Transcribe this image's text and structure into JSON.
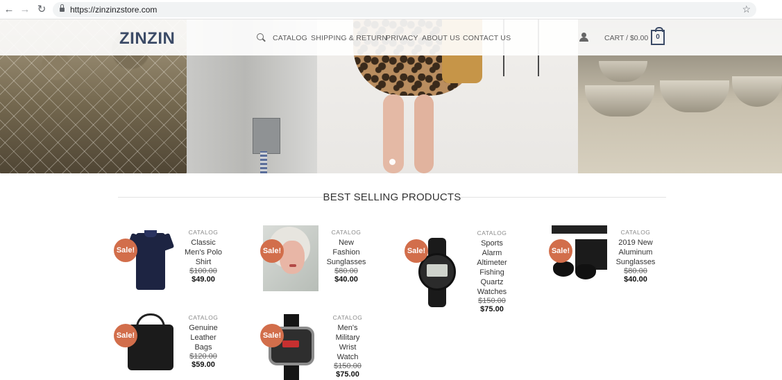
{
  "browser": {
    "url": "https://zinzinzstore.com",
    "back_glyph": "←",
    "forward_glyph": "→",
    "reload_glyph": "↻",
    "star_glyph": "☆"
  },
  "header": {
    "logo": "ZINZIN",
    "nav": [
      "CATALOG",
      "SHIPPING & RETURN",
      "PRIVACY",
      "ABOUT US",
      "CONTACT US"
    ],
    "cart_label": "CART / $0.00",
    "cart_count": "0"
  },
  "section": {
    "title": "BEST SELLING PRODUCTS"
  },
  "products": [
    {
      "category": "CATALOG",
      "name": "Classic Men's Polo Shirt",
      "old_price": "$100.00",
      "price": "$49.00",
      "badge": "Sale!"
    },
    {
      "category": "CATALOG",
      "name": "New Fashion Sunglasses",
      "old_price": "$80.00",
      "price": "$40.00",
      "badge": "Sale!"
    },
    {
      "category": "CATALOG",
      "name": "Sports Alarm Altimeter Fishing Quartz Watches",
      "old_price": "$150.00",
      "price": "$75.00",
      "badge": "Sale!"
    },
    {
      "category": "CATALOG",
      "name": "2019 New Aluminum Sunglasses",
      "old_price": "$80.00",
      "price": "$40.00",
      "badge": "Sale!"
    },
    {
      "category": "CATALOG",
      "name": "Genuine Leather Bags",
      "old_price": "$120.00",
      "price": "$59.00",
      "badge": "Sale!"
    },
    {
      "category": "CATALOG",
      "name": "Men's Military Wrist Watch",
      "old_price": "$150.00",
      "price": "$75.00",
      "badge": "Sale!"
    }
  ],
  "colors": {
    "brand": "#3b4a66",
    "sale_badge": "#d26e4b"
  }
}
